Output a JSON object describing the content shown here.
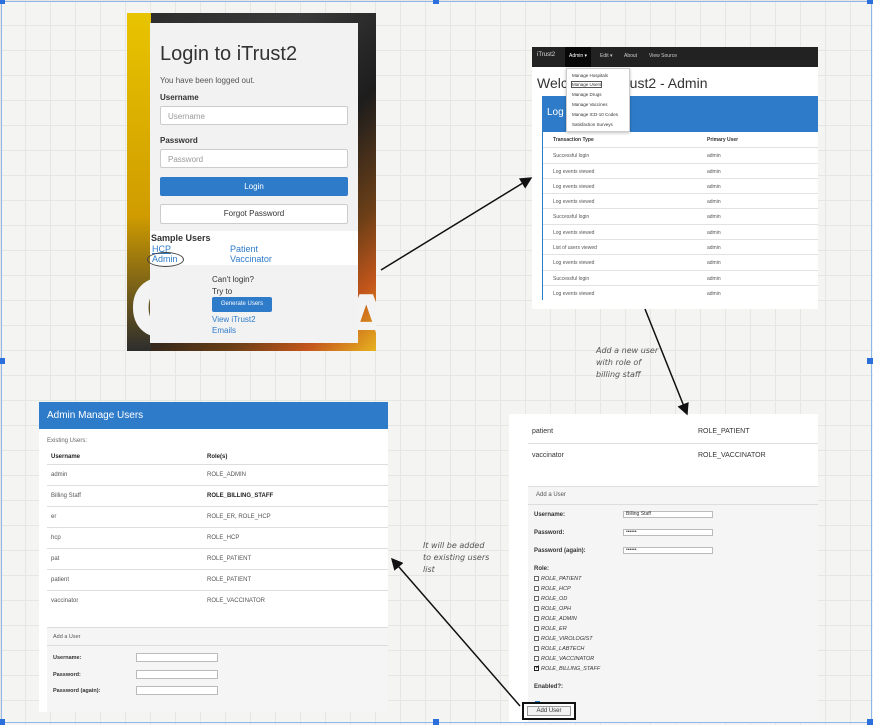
{
  "login": {
    "title": "Login to iTrust2",
    "message": "You have been logged out.",
    "username_label": "Username",
    "username_placeholder": "Username",
    "password_label": "Password",
    "password_placeholder": "Password",
    "login_button": "Login",
    "forgot_button": "Forgot Password",
    "sample_title": "Sample Users",
    "sample_users": [
      "HCP",
      "Patient",
      "Admin",
      "Vaccinator"
    ],
    "cant_login": "Can't login?",
    "try_to": "Try to",
    "generate_button": "Generate Users",
    "view_link_1": "View iTrust2",
    "view_link_2": "Emails"
  },
  "admin": {
    "brand": "iTrust2",
    "nav": [
      "Admin ▾",
      "Edit ▾",
      "About",
      "View Source"
    ],
    "dropdown": [
      "Manage Hospitals",
      "Manage Users",
      "Manage Drugs",
      "Manage Vaccines",
      "Manage ICD-10 Codes",
      "Satisfaction Surveys"
    ],
    "welcome": "Welcome to iTrust2 - Admin",
    "welcome_left": "Welc",
    "welcome_right": "rust2 - Admin",
    "log_heading": "Log",
    "columns": [
      "Transaction Type",
      "Primary User"
    ],
    "rows": [
      [
        "Successful login",
        "admin"
      ],
      [
        "Log events viewed",
        "admin"
      ],
      [
        "Log events viewed",
        "admin"
      ],
      [
        "Log events viewed",
        "admin"
      ],
      [
        "Successful login",
        "admin"
      ],
      [
        "Log events viewed",
        "admin"
      ],
      [
        "List of users viewed",
        "admin"
      ],
      [
        "Log events viewed",
        "admin"
      ],
      [
        "Successful login",
        "admin"
      ],
      [
        "Log events viewed",
        "admin"
      ]
    ]
  },
  "notes": {
    "add_user": [
      "Add a new user",
      "with role of",
      "billing staff"
    ],
    "added": [
      "It will be added",
      "to existing users",
      "list"
    ]
  },
  "form": {
    "top_rows": [
      [
        "patient",
        "ROLE_PATIENT"
      ],
      [
        "vaccinator",
        "ROLE_VACCINATOR"
      ]
    ],
    "title": "Add a User",
    "username_label": "Username:",
    "username_value": "Billing Staff",
    "password_label": "Password:",
    "password_value": "••••••",
    "password2_label": "Password (again):",
    "password2_value": "••••••",
    "role_label": "Role:",
    "roles": [
      "ROLE_PATIENT",
      "ROLE_HCP",
      "ROLE_OD",
      "ROLE_OPH",
      "ROLE_ADMIN",
      "ROLE_ER",
      "ROLE_VIROLOGIST",
      "ROLE_LABTECH",
      "ROLE_VACCINATOR",
      "ROLE_BILLING_STAFF"
    ],
    "enabled_label": "Enabled?:",
    "add_button": "Add User"
  },
  "manage": {
    "title": "Admin Manage Users",
    "existing": "Existing Users:",
    "columns": [
      "Username",
      "Role(s)"
    ],
    "rows": [
      [
        "admin",
        "ROLE_ADMIN"
      ],
      [
        "Billing Staff",
        "ROLE_BILLING_STAFF"
      ],
      [
        "er",
        "ROLE_ER, ROLE_HCP"
      ],
      [
        "hcp",
        "ROLE_HCP"
      ],
      [
        "pat",
        "ROLE_PATIENT"
      ],
      [
        "patient",
        "ROLE_PATIENT"
      ],
      [
        "vaccinator",
        "ROLE_VACCINATOR"
      ]
    ],
    "form_title": "Add a User",
    "username_label": "Username:",
    "password_label": "Password:",
    "password2_label": "Password (again):"
  },
  "colors": {
    "accent": "#2e7bc9",
    "navbar": "#222222"
  }
}
